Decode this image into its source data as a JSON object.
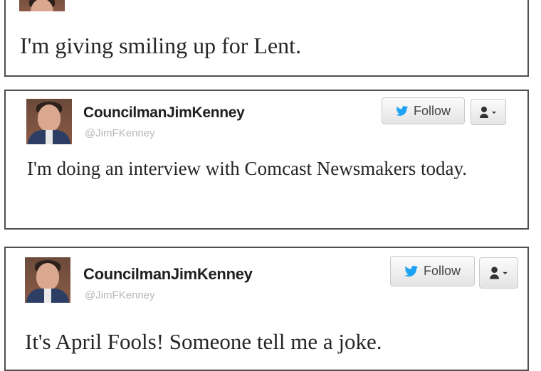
{
  "tweets": [
    {
      "text": "I'm giving smiling up for Lent."
    },
    {
      "name": "CouncilmanJimKenney",
      "handle": "@JimFKenney",
      "follow_label": "Follow",
      "text": "I'm doing an interview with Comcast Newsmakers today."
    },
    {
      "name": "CouncilmanJimKenney",
      "handle": "@JimFKenney",
      "follow_label": "Follow",
      "text": "It's April Fools! Someone tell me a joke."
    }
  ],
  "icons": {
    "follow": "twitter-bird-icon",
    "user_menu": "user-dropdown-icon"
  },
  "colors": {
    "follow_bird": "#1da1f2",
    "text": "#262626",
    "handle": "#b7b7b7"
  }
}
